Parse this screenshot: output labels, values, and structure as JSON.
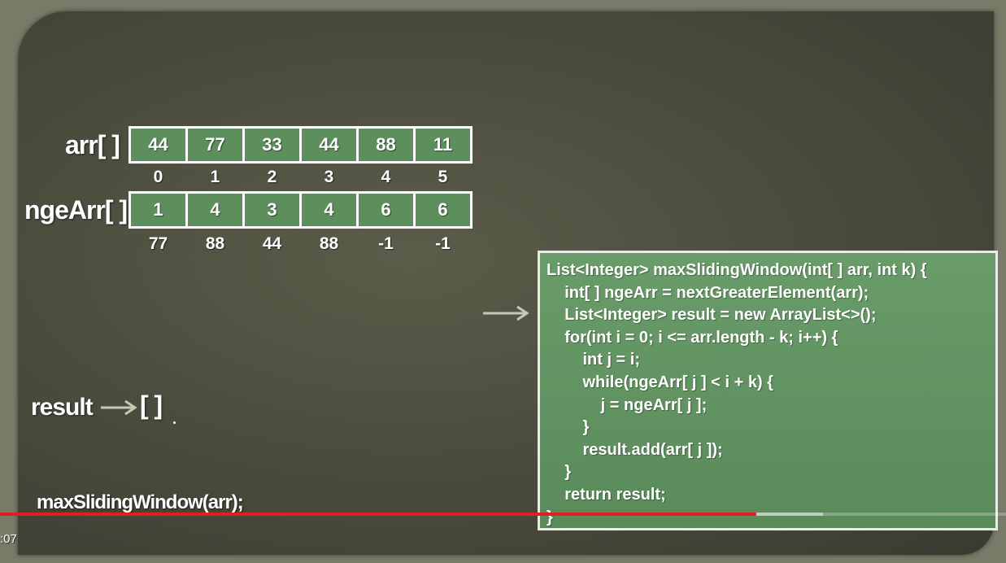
{
  "slide": {
    "arr_label": "arr[ ]",
    "nge_label": "ngeArr[ ]",
    "arr_values": [
      "44",
      "77",
      "33",
      "44",
      "88",
      "11"
    ],
    "arr_indices": [
      "0",
      "1",
      "2",
      "3",
      "4",
      "5"
    ],
    "nge_values": [
      "1",
      "4",
      "3",
      "4",
      "6",
      "6"
    ],
    "nge_next_values": [
      "77",
      "88",
      "44",
      "88",
      "-1",
      "-1"
    ],
    "result_label": "result",
    "result_value": "[ ]",
    "call_text": "maxSlidingWindow(arr);",
    "code_lines": [
      "List<Integer> maxSlidingWindow(int[ ] arr, int k) {",
      "    int[ ] ngeArr = nextGreaterElement(arr);",
      "    List<Integer> result = new ArrayList<>();",
      "    for(int i = 0; i <= arr.length - k; i++) {",
      "        int j = i;",
      "        while(ngeArr[ j ] < i + k) {",
      "            j = ngeArr[ j ];",
      "        }",
      "        result.add(arr[ j ]);",
      "    }",
      "    return result;",
      "}"
    ]
  },
  "player": {
    "time": ":07",
    "played_fraction": 0.752,
    "buffered_fraction": 0.818
  },
  "colors": {
    "cell_green": "#5d8f5d",
    "code_green": "#6a9c6a",
    "progress_red": "#e02020"
  }
}
